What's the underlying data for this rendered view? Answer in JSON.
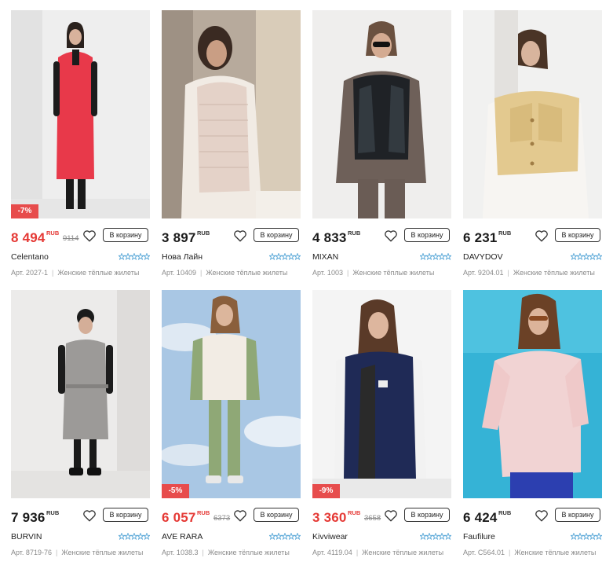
{
  "colors": {
    "sale": "#e53935",
    "star": "#5aa8d8",
    "badge": "#e74c4c"
  },
  "products": [
    {
      "brand": "Celentano",
      "price": "8 494",
      "currency": "RUB",
      "old_price": "9114",
      "discount": "-7%",
      "sale": true,
      "cart": "В корзину",
      "article": "Арт. 2027-1",
      "category": "Женские тёплые жилеты"
    },
    {
      "brand": "Нова Лайн",
      "price": "3 897",
      "currency": "RUB",
      "old_price": "",
      "discount": "",
      "sale": false,
      "cart": "В корзину",
      "article": "Арт. 10409",
      "category": "Женские тёплые жилеты"
    },
    {
      "brand": "MIXAN",
      "price": "4 833",
      "currency": "RUB",
      "old_price": "",
      "discount": "",
      "sale": false,
      "cart": "В корзину",
      "article": "Арт. 1003",
      "category": "Женские тёплые жилеты"
    },
    {
      "brand": "DAVYDOV",
      "price": "6 231",
      "currency": "RUB",
      "old_price": "",
      "discount": "",
      "sale": false,
      "cart": "В корзину",
      "article": "Арт. 9204.01",
      "category": "Женские тёплые жилеты"
    },
    {
      "brand": "BURVIN",
      "price": "7 936",
      "currency": "RUB",
      "old_price": "",
      "discount": "",
      "sale": false,
      "cart": "В корзину",
      "article": "Арт. 8719-76",
      "category": "Женские тёплые жилеты"
    },
    {
      "brand": "AVE RARA",
      "price": "6 057",
      "currency": "RUB",
      "old_price": "6373",
      "discount": "-5%",
      "sale": true,
      "cart": "В корзину",
      "article": "Арт. 1038.3",
      "category": "Женские тёплые жилеты"
    },
    {
      "brand": "Kivviwear",
      "price": "3 360",
      "currency": "RUB",
      "old_price": "3658",
      "discount": "-9%",
      "sale": true,
      "cart": "В корзину",
      "article": "Арт. 4119.04",
      "category": "Женские тёплые жилеты"
    },
    {
      "brand": "Faufilure",
      "price": "6 424",
      "currency": "RUB",
      "old_price": "",
      "discount": "",
      "sale": false,
      "cart": "В корзину",
      "article": "Арт. C564.01",
      "category": "Женские тёплые жилеты"
    }
  ]
}
